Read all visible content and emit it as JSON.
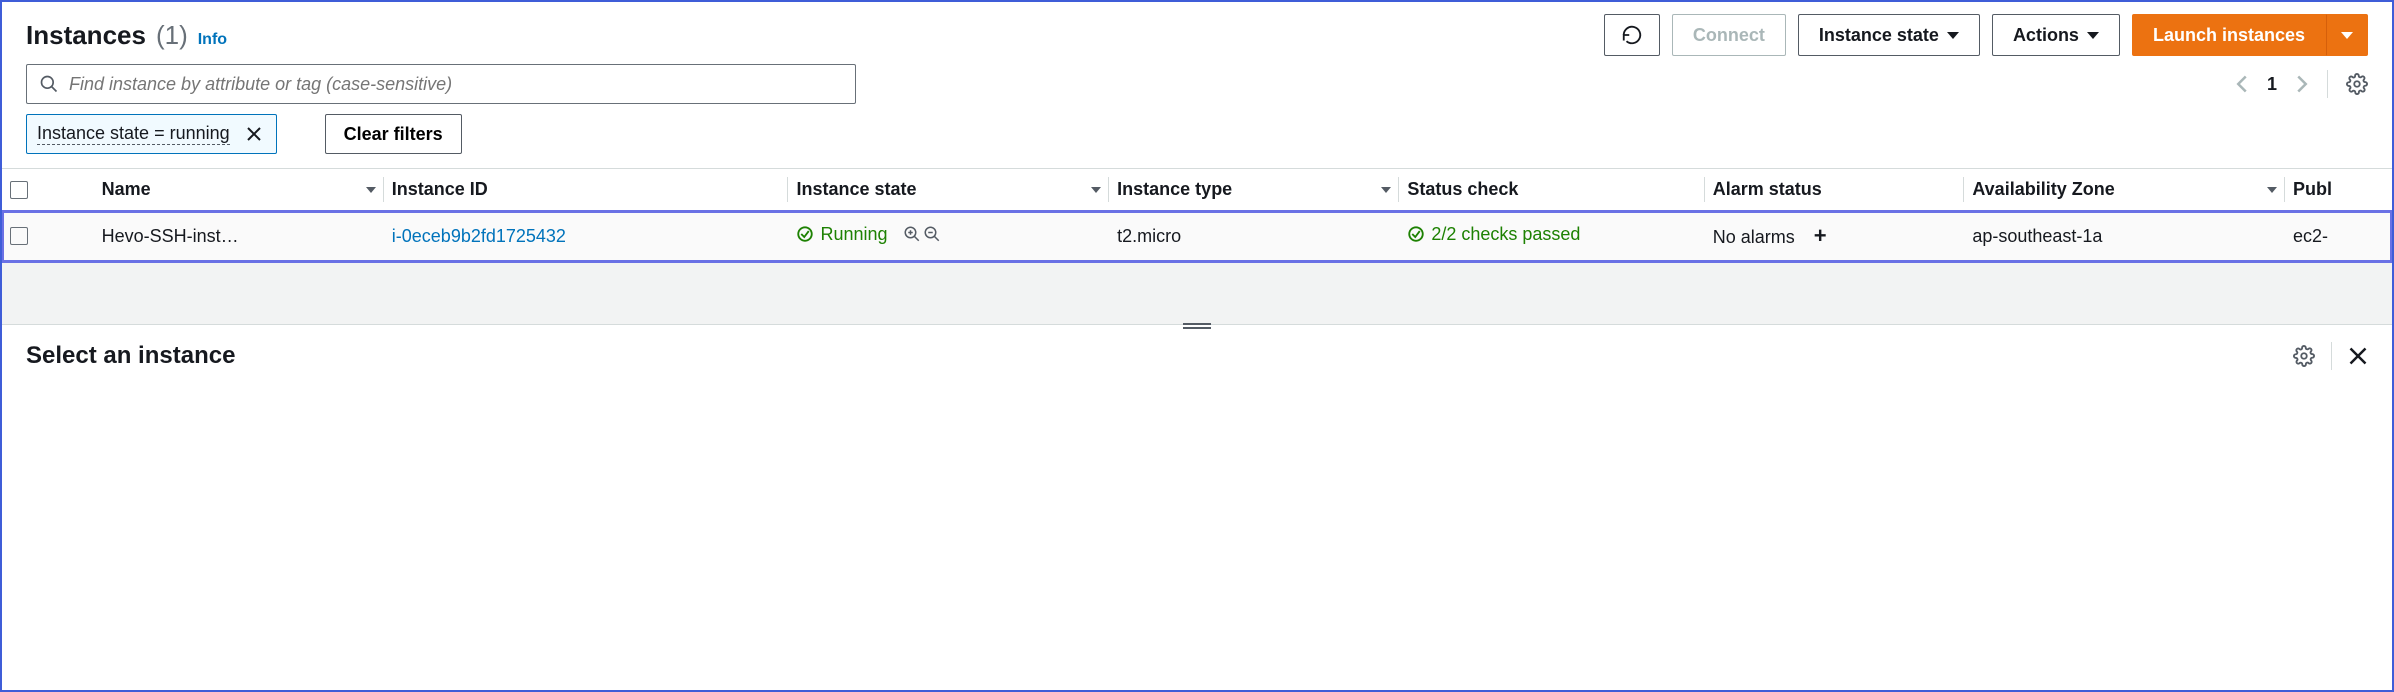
{
  "header": {
    "title": "Instances",
    "count": "(1)",
    "info": "Info",
    "connect": "Connect",
    "instance_state": "Instance state",
    "actions": "Actions",
    "launch": "Launch instances"
  },
  "search": {
    "placeholder": "Find instance by attribute or tag (case-sensitive)",
    "page": "1"
  },
  "filters": {
    "chip": "Instance state = running",
    "clear": "Clear filters"
  },
  "columns": {
    "name": "Name",
    "instance_id": "Instance ID",
    "instance_state": "Instance state",
    "instance_type": "Instance type",
    "status_check": "Status check",
    "alarm_status": "Alarm status",
    "availability_zone": "Availability Zone",
    "public": "Publ"
  },
  "rows": [
    {
      "name": "Hevo-SSH-inst…",
      "instance_id": "i-0eceb9b2fd1725432",
      "state": "Running",
      "type": "t2.micro",
      "status": "2/2 checks passed",
      "alarm": "No alarms",
      "az": "ap-southeast-1a",
      "public": "ec2-"
    }
  ],
  "detail": {
    "title": "Select an instance"
  }
}
